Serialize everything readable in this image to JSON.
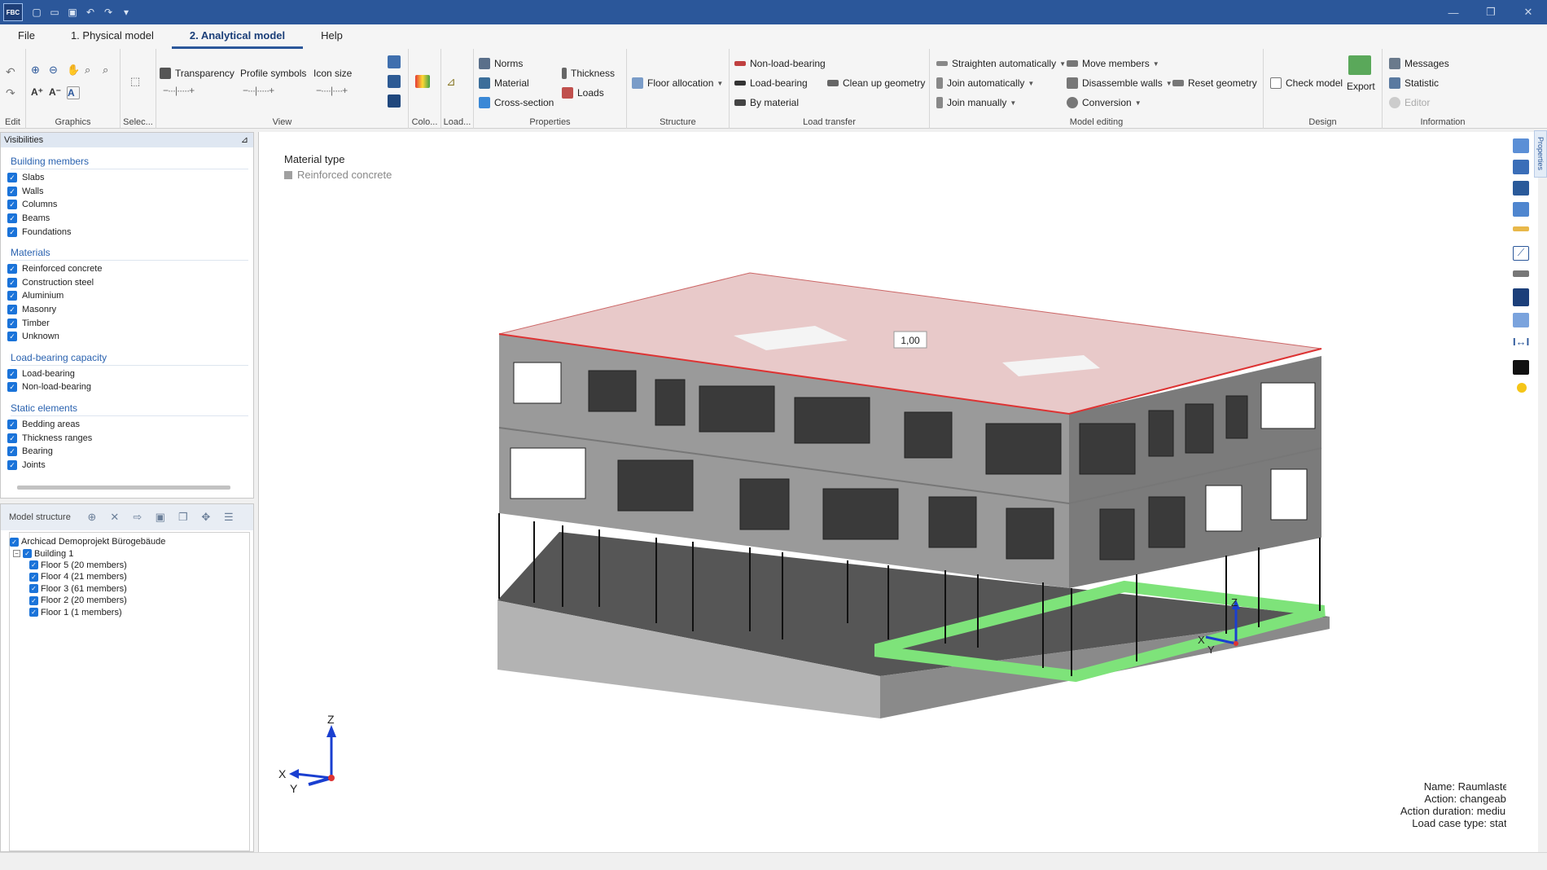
{
  "titlebar": {
    "logo": "FBC"
  },
  "menu": {
    "file": "File",
    "tab1": "1. Physical model",
    "tab2": "2. Analytical model",
    "help": "Help"
  },
  "ribbon": {
    "groups": {
      "edit": "Edit",
      "graphics": "Graphics",
      "selection": "Selec...",
      "view": "View",
      "colors": "Colo...",
      "load": "Load...",
      "properties": "Properties",
      "structure": "Structure",
      "load_transfer": "Load transfer",
      "model_editing": "Model editing",
      "design": "Design",
      "information": "Information"
    },
    "view": {
      "transparency": "Transparency",
      "profile_symbols": "Profile symbols",
      "icon_size": "Icon size"
    },
    "properties": {
      "norms": "Norms",
      "material": "Material",
      "cross_section": "Cross-section",
      "thickness": "Thickness",
      "loads": "Loads"
    },
    "structure": {
      "floor_allocation": "Floor allocation"
    },
    "load_transfer": {
      "non_load_bearing": "Non-load-bearing",
      "load_bearing": "Load-bearing",
      "by_material": "By material",
      "clean_up_geometry": "Clean up geometry"
    },
    "model_editing": {
      "straighten": "Straighten automatically",
      "join_auto": "Join automatically",
      "join_manual": "Join manually",
      "move_members": "Move members",
      "disassemble_walls": "Disassemble walls",
      "conversion": "Conversion",
      "reset_geometry": "Reset geometry"
    },
    "design": {
      "check_model": "Check model",
      "export": "Export"
    },
    "information": {
      "messages": "Messages",
      "statistic": "Statistic",
      "editor": "Editor"
    }
  },
  "visibilities": {
    "title": "Visibilities",
    "sections": [
      {
        "title": "Building members",
        "items": [
          "Slabs",
          "Walls",
          "Columns",
          "Beams",
          "Foundations"
        ]
      },
      {
        "title": "Materials",
        "items": [
          "Reinforced concrete",
          "Construction steel",
          "Aluminium",
          "Masonry",
          "Timber",
          "Unknown"
        ]
      },
      {
        "title": "Load-bearing capacity",
        "items": [
          "Load-bearing",
          "Non-load-bearing"
        ]
      },
      {
        "title": "Static elements",
        "items": [
          "Bedding areas",
          "Thickness ranges",
          "Bearing",
          "Joints"
        ]
      }
    ]
  },
  "model_structure": {
    "title": "Model structure",
    "project": "Archicad Demoprojekt Bürogebäude",
    "building": "Building 1",
    "floors": [
      "Floor 5 (20 members)",
      "Floor 4 (21 members)",
      "Floor 3 (61 members)",
      "Floor 2 (20 members)",
      "Floor 1 (1 members)"
    ]
  },
  "viewport": {
    "material_type_label": "Material type",
    "material_legend": "Reinforced concrete",
    "load_value": "1,00",
    "axes": {
      "x": "X",
      "y": "Y",
      "z": "Z"
    },
    "info_lines": [
      "Name: Raumlasten",
      "Action: changeable",
      "Action duration: medium",
      "Load case type: static"
    ]
  },
  "properties_tab": "Properties",
  "colors": {
    "accent": "#2b579a",
    "load_surface": "#e8c9c9",
    "bedding": "#7ee37a",
    "checkbox": "#1a73d9"
  }
}
